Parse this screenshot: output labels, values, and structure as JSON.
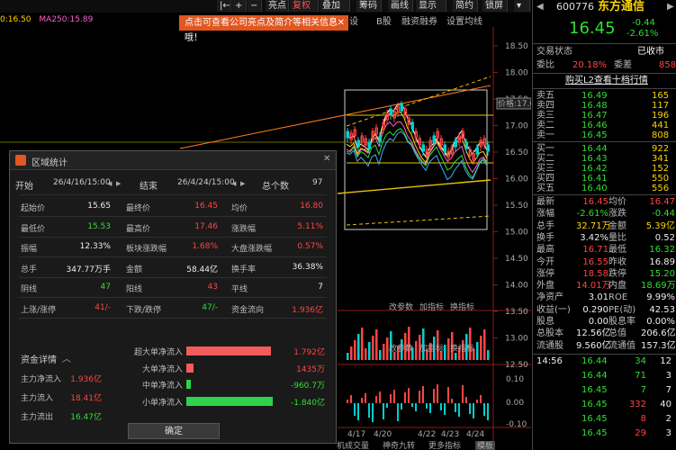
{
  "top": {
    "ma_legend": [
      "0:16.50",
      "MA250:15.89"
    ],
    "toolbar": [
      {
        "label": "亮点"
      },
      {
        "label": "复权"
      },
      {
        "label": "叠加"
      },
      {
        "label": "筹码"
      },
      {
        "label": "画线"
      },
      {
        "label": "显示"
      },
      {
        "label": "简约"
      },
      {
        "label": "锁屏"
      }
    ],
    "toolbar_symbols": [
      "|←",
      "+",
      "−"
    ],
    "toolbar2": [
      "设",
      "B股",
      "融资融券",
      "设置均线"
    ],
    "promo_text": "点击可查看公司亮点及简介等相关信息哦！",
    "promo_close": "✕"
  },
  "chart": {
    "price_ticks": [
      "18.50",
      "18.00",
      "17.50",
      "17.00",
      "16.50",
      "16.00",
      "15.50",
      "15.00",
      "14.50",
      "14.00",
      "13.50",
      "13.00",
      "12.50"
    ],
    "price_label": "价格:17.68",
    "vol_ticks": [
      "0.10",
      "0.00",
      "-0.10"
    ],
    "date_ticks": [
      "4/17",
      "4/20",
      "4/22",
      "4/23",
      "4/24"
    ],
    "sub_buttons": [
      "改参数",
      "加指标",
      "换指标"
    ],
    "sub_buttons2": [
      "改参数",
      "加指标",
      "换指标"
    ],
    "bottom_tabs": [
      "机成交量",
      "神奇九转",
      "更多指标",
      "模板"
    ]
  },
  "quote": {
    "code": "600776",
    "name": "东方通信",
    "price": "16.45",
    "change": "-0.44",
    "change_pct": "-2.61%",
    "status_label": "交易状态",
    "status_value": "已收市",
    "weibi_label": "委比",
    "weibi_value": "20.18%",
    "weicha_label": "委差",
    "weicha_value": "858",
    "l2_link": "购买L2查看十档行情",
    "asks": [
      {
        "label": "卖五",
        "price": "16.49",
        "vol": "165"
      },
      {
        "label": "卖四",
        "price": "16.48",
        "vol": "117"
      },
      {
        "label": "卖三",
        "price": "16.47",
        "vol": "196"
      },
      {
        "label": "卖二",
        "price": "16.46",
        "vol": "441"
      },
      {
        "label": "卖一",
        "price": "16.45",
        "vol": "808"
      }
    ],
    "bids": [
      {
        "label": "买一",
        "price": "16.44",
        "vol": "922"
      },
      {
        "label": "买二",
        "price": "16.43",
        "vol": "341"
      },
      {
        "label": "买三",
        "price": "16.42",
        "vol": "152"
      },
      {
        "label": "买四",
        "price": "16.41",
        "vol": "550"
      },
      {
        "label": "买五",
        "price": "16.40",
        "vol": "556"
      }
    ],
    "stats": [
      {
        "l1": "最新",
        "v1": "16.45",
        "c1": "red",
        "l2": "均价",
        "v2": "16.47",
        "c2": "red"
      },
      {
        "l1": "涨幅",
        "v1": "-2.61%",
        "c1": "green",
        "l2": "涨跌",
        "v2": "-0.44",
        "c2": "green"
      },
      {
        "l1": "总手",
        "v1": "32.71万",
        "c1": "yellow",
        "l2": "金额",
        "v2": "5.39亿",
        "c2": "yellow"
      },
      {
        "l1": "换手",
        "v1": "3.42%",
        "c1": "white",
        "l2": "量比",
        "v2": "0.52",
        "c2": "white"
      },
      {
        "l1": "最高",
        "v1": "16.71",
        "c1": "red",
        "l2": "最低",
        "v2": "16.32",
        "c2": "green"
      },
      {
        "l1": "今开",
        "v1": "16.55",
        "c1": "red",
        "l2": "昨收",
        "v2": "16.89",
        "c2": "white"
      },
      {
        "l1": "涨停",
        "v1": "18.58",
        "c1": "red",
        "l2": "跌停",
        "v2": "15.20",
        "c2": "green"
      },
      {
        "l1": "外盘",
        "v1": "14.01万",
        "c1": "red",
        "l2": "内盘",
        "v2": "18.69万",
        "c2": "green"
      },
      {
        "l1": "净资产",
        "v1": "3.01",
        "c1": "white",
        "l2": "ROE",
        "v2": "9.99%",
        "c2": "white"
      },
      {
        "l1": "收益(一)",
        "v1": "0.290",
        "c1": "white",
        "l2": "PE(动)",
        "v2": "42.53",
        "c2": "white"
      },
      {
        "l1": "股息",
        "v1": "0.00",
        "c1": "white",
        "l2": "股息率",
        "v2": "0.00%",
        "c2": "white"
      },
      {
        "l1": "总股本",
        "v1": "12.56亿",
        "c1": "white",
        "l2": "总值",
        "v2": "206.6亿",
        "c2": "white"
      },
      {
        "l1": "流通股",
        "v1": "9.560亿",
        "c1": "white",
        "l2": "流通值",
        "v2": "157.3亿",
        "c2": "white"
      }
    ],
    "ttm_mark": "TTM",
    "ticks": [
      {
        "time": "14:56",
        "price": "16.44",
        "vol": "34",
        "n": "12",
        "pc": "green",
        "vc": "green"
      },
      {
        "time": "",
        "price": "16.44",
        "vol": "71",
        "n": "3",
        "pc": "green",
        "vc": "green"
      },
      {
        "time": "",
        "price": "16.45",
        "vol": "7",
        "n": "7",
        "pc": "green",
        "vc": "green"
      },
      {
        "time": "",
        "price": "16.45",
        "vol": "332",
        "n": "40",
        "pc": "green",
        "vc": "red"
      },
      {
        "time": "",
        "price": "16.45",
        "vol": "8",
        "n": "2",
        "pc": "green",
        "vc": "red"
      },
      {
        "time": "",
        "price": "16.45",
        "vol": "29",
        "n": "3",
        "pc": "green",
        "vc": "red"
      }
    ]
  },
  "dialog": {
    "title": "区域统计",
    "start_label": "开始",
    "start_value": "26/4/16/15:00",
    "end_label": "结束",
    "end_value": "26/4/24/15:00",
    "count_label": "总个数",
    "count_value": "97",
    "rows": [
      [
        {
          "label": "起始价",
          "value": "15.65",
          "color": "white"
        },
        {
          "label": "最终价",
          "value": "16.45",
          "color": "red"
        },
        {
          "label": "均价",
          "value": "16.80",
          "color": "red"
        }
      ],
      [
        {
          "label": "最低价",
          "value": "15.53",
          "color": "green"
        },
        {
          "label": "最高价",
          "value": "17.46",
          "color": "red"
        },
        {
          "label": "涨跌幅",
          "value": "5.11%",
          "color": "red"
        }
      ],
      [
        {
          "label": "振幅",
          "value": "12.33%",
          "color": "white"
        },
        {
          "label": "板块涨跌幅",
          "value": "1.68%",
          "color": "red"
        },
        {
          "label": "大盘涨跌幅",
          "value": "0.57%",
          "color": "red"
        }
      ],
      [
        {
          "label": "总手",
          "value": "347.77万手",
          "color": "white"
        },
        {
          "label": "金额",
          "value": "58.44亿",
          "color": "white"
        },
        {
          "label": "换手率",
          "value": "36.38%",
          "color": "white"
        }
      ],
      [
        {
          "label": "阴线",
          "value": "47",
          "color": "green"
        },
        {
          "label": "阳线",
          "value": "43",
          "color": "red"
        },
        {
          "label": "平线",
          "value": "7",
          "color": "white"
        }
      ],
      [
        {
          "label": "上涨/涨停",
          "value": "41/-",
          "color": "red"
        },
        {
          "label": "下跌/跌停",
          "value": "47/-",
          "color": "green"
        },
        {
          "label": "资金流向",
          "value": "1.936亿",
          "color": "red"
        }
      ]
    ],
    "funds_header": "资金详情",
    "funds": [
      {
        "label": "主力净流入",
        "value": "1.936亿",
        "color": "red"
      },
      {
        "label": "主力流入",
        "value": "18.41亿",
        "color": "red"
      },
      {
        "label": "主力流出",
        "value": "16.47亿",
        "color": "green"
      }
    ],
    "flows": [
      {
        "label": "超大单净流入",
        "value": "1.792亿",
        "color": "red",
        "amount_wan": 17920
      },
      {
        "label": "大单净流入",
        "value": "1435万",
        "color": "red",
        "amount_wan": 1435
      },
      {
        "label": "中单净流入",
        "value": "-960.7万",
        "color": "green",
        "amount_wan": -960.7
      },
      {
        "label": "小单净流入",
        "value": "-1.840亿",
        "color": "green",
        "amount_wan": -18400
      }
    ],
    "ok_label": "确定"
  },
  "colors": {
    "up": "#ff4444",
    "down": "#33dd33",
    "accent": "#e2561f",
    "flow_up": "#f25c5c",
    "flow_down": "#2fd34a"
  }
}
